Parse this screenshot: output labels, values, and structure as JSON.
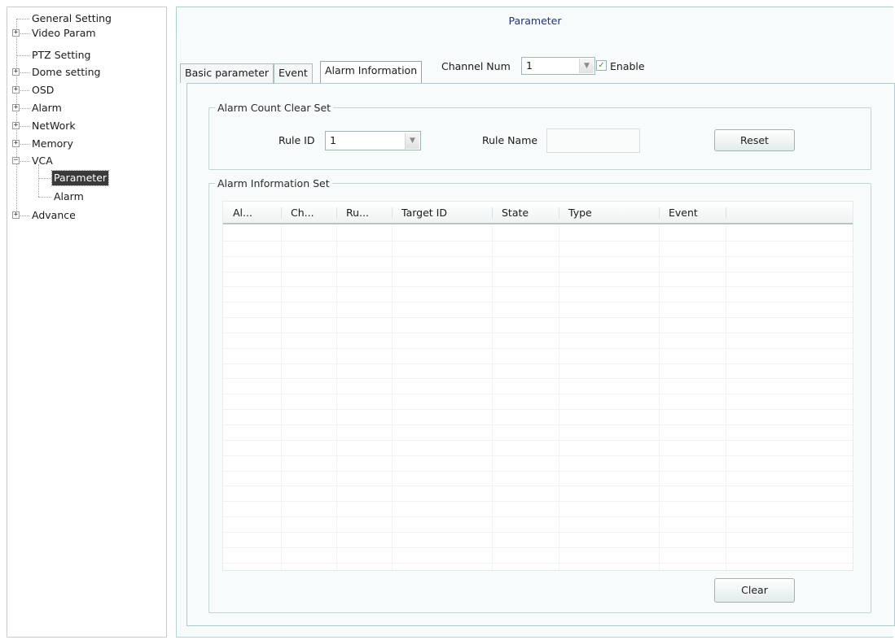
{
  "tree": {
    "items": [
      {
        "label": "General Setting",
        "expander": "",
        "name": "tree-item-general-setting"
      },
      {
        "label": "Video Param",
        "expander": "+",
        "name": "tree-item-video-param"
      },
      {
        "label": "PTZ Setting",
        "expander": "",
        "name": "tree-item-ptz-setting"
      },
      {
        "label": "Dome setting",
        "expander": "+",
        "name": "tree-item-dome-setting"
      },
      {
        "label": "OSD",
        "expander": "+",
        "name": "tree-item-osd"
      },
      {
        "label": "Alarm",
        "expander": "+",
        "name": "tree-item-alarm"
      },
      {
        "label": "NetWork",
        "expander": "+",
        "name": "tree-item-network"
      },
      {
        "label": "Memory",
        "expander": "+",
        "name": "tree-item-memory"
      },
      {
        "label": "VCA",
        "expander": "−",
        "name": "tree-item-vca"
      },
      {
        "label": "Parameter",
        "expander": "",
        "name": "tree-item-vca-parameter",
        "selected": true
      },
      {
        "label": "Alarm",
        "expander": "",
        "name": "tree-item-vca-alarm"
      },
      {
        "label": "Advance",
        "expander": "+",
        "name": "tree-item-advance"
      }
    ]
  },
  "header": {
    "title": "Parameter"
  },
  "tabs": [
    {
      "label": "Basic parameter",
      "active": false
    },
    {
      "label": "Event",
      "active": false
    },
    {
      "label": "Alarm Information",
      "active": true
    }
  ],
  "channel": {
    "label": "Channel Num",
    "value": "1",
    "enable_label": "Enable",
    "enable_checked": true
  },
  "alarm_count_clear": {
    "legend": "Alarm Count Clear Set",
    "rule_id_label": "Rule ID",
    "rule_id_value": "1",
    "rule_name_label": "Rule Name",
    "rule_name_value": "",
    "reset_label": "Reset"
  },
  "alarm_info": {
    "legend": "Alarm Information Set",
    "columns": [
      "Al...",
      "Ch...",
      "Ru...",
      "Target ID",
      "State",
      "Type",
      "Event",
      ""
    ],
    "rows": [],
    "clear_label": "Clear"
  },
  "icons": {
    "expand": "plus-box-icon",
    "collapse": "minus-box-icon",
    "dropdown": "chevron-down-icon",
    "check": "checkmark-icon"
  }
}
